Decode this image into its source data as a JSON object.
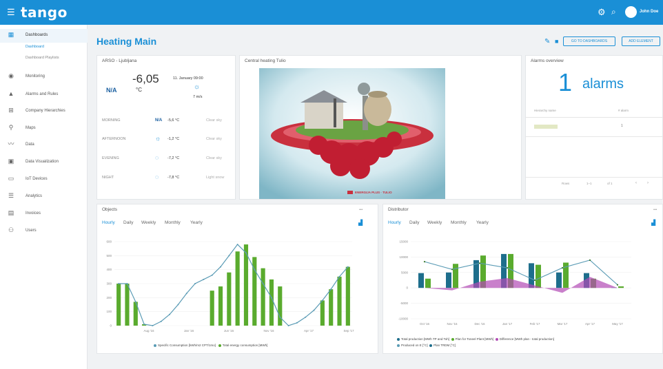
{
  "topbar": {
    "menu_icon": "hamburger-icon",
    "logo": "tango",
    "logo_sub": "",
    "user": "John Doe"
  },
  "sidebar": {
    "items": [
      {
        "label": "Dashboards",
        "icon": "dashboard-icon"
      },
      {
        "label": "Monitoring",
        "icon": "bulb-icon"
      },
      {
        "label": "Alarms and Rules",
        "icon": "warning-icon"
      },
      {
        "label": "Company Hierarchies",
        "icon": "hierarchy-icon"
      },
      {
        "label": "Maps",
        "icon": "map-pin-icon"
      },
      {
        "label": "Data",
        "icon": "chart-line-icon"
      },
      {
        "label": "Data Visualization",
        "icon": "grid-icon"
      },
      {
        "label": "IoT Devices",
        "icon": "device-icon"
      },
      {
        "label": "Analytics",
        "icon": "analytics-icon"
      },
      {
        "label": "Invoices",
        "icon": "invoice-icon"
      },
      {
        "label": "Users",
        "icon": "users-icon"
      }
    ],
    "sub_active": "Dashboard",
    "sub_other": "Dashboard Playlists"
  },
  "header": {
    "title": "Heating Main",
    "go_btn": "GO TO DASHBOARDS",
    "add_btn": "ADD ELEMENT"
  },
  "weather": {
    "title": "ARSO - Ljubljana",
    "na": "N/A",
    "temp": "-6,05",
    "unit": "°C",
    "date": "11. January 09:00",
    "wind": "7 m/s",
    "rows": [
      {
        "period": "MORNING",
        "temp": "-5,6 °C",
        "desc": "Clear sky"
      },
      {
        "period": "AFTERNOON",
        "temp": "-1,2 °C",
        "desc": "Clear sky"
      },
      {
        "period": "EVENING",
        "temp": "-7,2 °C",
        "desc": "Clear sky"
      },
      {
        "period": "NIGHT",
        "temp": "-7,8 °C",
        "desc": "Light snow"
      }
    ]
  },
  "image_card": {
    "title": "Central heating Tulio",
    "caption": "ENERGIJA PLUS · TULIO"
  },
  "alarms": {
    "title": "Alarms overview",
    "count": "1",
    "word": "alarms",
    "col1": "Hierarchy name",
    "col2": "# alarm",
    "value": "1",
    "pager": [
      "Rows",
      "1–1",
      "of 1",
      "‹",
      "›"
    ]
  },
  "objects": {
    "title": "Objects",
    "tabs": [
      "Hourly",
      "Daily",
      "Weekly",
      "Monthly",
      "Yearly"
    ],
    "legend": [
      "Specific Consumption [kWh/m2 CPT/1mo]",
      "Total energy consumption [MWh]"
    ]
  },
  "distributor": {
    "title": "Distributor",
    "tabs": [
      "Hourly",
      "Daily",
      "Weekly",
      "Monthly",
      "Yearly"
    ],
    "legend": [
      "Total production [MWh TP and Toh]",
      "Plan for Toneel Plant [MWh]",
      "Difference [MWh plan - total production]",
      "Produced on E [°C]",
      "Plan TRDM [°C]"
    ]
  },
  "colors": {
    "accent": "#1a8fd6",
    "bar_green": "#5aab2e",
    "bar_teal": "#1e6e8c",
    "area_purple": "#b24ab5",
    "line": "#5a9bb5"
  },
  "chart_data": [
    {
      "type": "bar",
      "title": "Objects",
      "categories": [
        "1",
        "2",
        "3",
        "4",
        "5",
        "6",
        "7",
        "8",
        "9",
        "10",
        "11",
        "12",
        "13",
        "14",
        "15",
        "16",
        "17",
        "18",
        "19",
        "20",
        "21",
        "22",
        "23",
        "24",
        "25",
        "26",
        "27",
        "28"
      ],
      "series": [
        {
          "type": "bar",
          "values": [
            300,
            300,
            170,
            10,
            0,
            0,
            0,
            0,
            0,
            0,
            0,
            250,
            280,
            380,
            530,
            580,
            490,
            410,
            330,
            280,
            0,
            0,
            0,
            0,
            180,
            260,
            350,
            420
          ]
        },
        {
          "type": "line",
          "values": [
            300,
            300,
            170,
            10,
            0,
            30,
            80,
            150,
            230,
            300,
            330,
            360,
            420,
            500,
            580,
            520,
            400,
            300,
            200,
            60,
            0,
            20,
            60,
            110,
            180,
            260,
            350,
            420
          ]
        }
      ],
      "xlabels": [
        "Aug '16",
        "Jan '16",
        "Jun '16",
        "Nov '16",
        "Apr '17",
        "Sep '17"
      ],
      "ylim": [
        0,
        600
      ]
    },
    {
      "type": "bar",
      "title": "Distributor",
      "categories": [
        "1",
        "2",
        "3",
        "4",
        "5",
        "6",
        "7",
        "8"
      ],
      "series": [
        {
          "type": "bar",
          "values": [
            4800,
            5000,
            9000,
            11000,
            8000,
            5000,
            4800,
            100
          ]
        },
        {
          "type": "bar",
          "values": [
            3000,
            7800,
            10500,
            11000,
            7500,
            8200,
            3000,
            500
          ]
        },
        {
          "type": "area",
          "values": [
            0,
            -200,
            500,
            800,
            200,
            -400,
            900,
            0
          ]
        },
        {
          "type": "line",
          "values": [
            8500,
            6000,
            8000,
            6500,
            2500,
            6500,
            9000,
            1000
          ]
        }
      ],
      "xlabels": [
        "Oct '16",
        "Nov '16",
        "Dec '16",
        "Jan '17",
        "Feb '17",
        "Mar '17",
        "Apr '17",
        "May '17"
      ],
      "ylim": [
        -10000,
        15000
      ]
    }
  ]
}
